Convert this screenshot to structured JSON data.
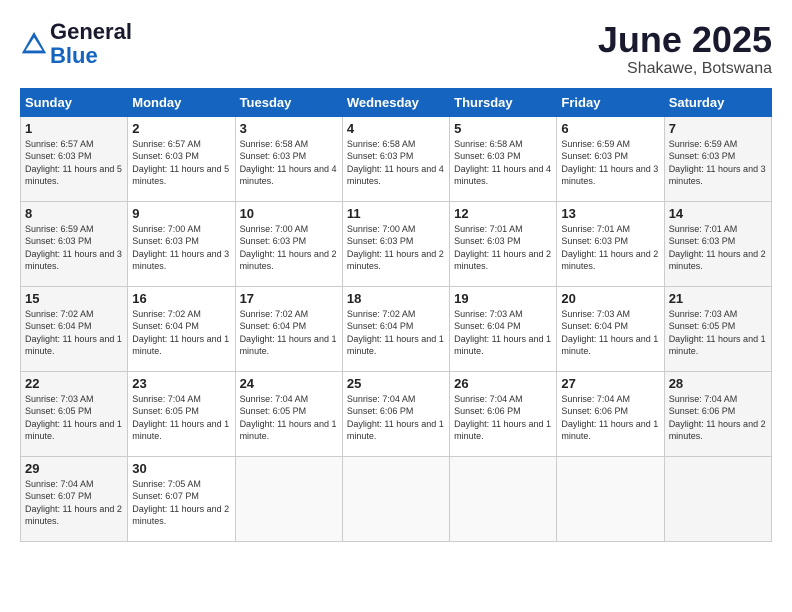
{
  "logo": {
    "general": "General",
    "blue": "Blue"
  },
  "title": {
    "month": "June 2025",
    "location": "Shakawe, Botswana"
  },
  "weekdays": [
    "Sunday",
    "Monday",
    "Tuesday",
    "Wednesday",
    "Thursday",
    "Friday",
    "Saturday"
  ],
  "weeks": [
    [
      {
        "day": "1",
        "info": "Sunrise: 6:57 AM\nSunset: 6:03 PM\nDaylight: 11 hours and 5 minutes."
      },
      {
        "day": "2",
        "info": "Sunrise: 6:57 AM\nSunset: 6:03 PM\nDaylight: 11 hours and 5 minutes."
      },
      {
        "day": "3",
        "info": "Sunrise: 6:58 AM\nSunset: 6:03 PM\nDaylight: 11 hours and 4 minutes."
      },
      {
        "day": "4",
        "info": "Sunrise: 6:58 AM\nSunset: 6:03 PM\nDaylight: 11 hours and 4 minutes."
      },
      {
        "day": "5",
        "info": "Sunrise: 6:58 AM\nSunset: 6:03 PM\nDaylight: 11 hours and 4 minutes."
      },
      {
        "day": "6",
        "info": "Sunrise: 6:59 AM\nSunset: 6:03 PM\nDaylight: 11 hours and 3 minutes."
      },
      {
        "day": "7",
        "info": "Sunrise: 6:59 AM\nSunset: 6:03 PM\nDaylight: 11 hours and 3 minutes."
      }
    ],
    [
      {
        "day": "8",
        "info": "Sunrise: 6:59 AM\nSunset: 6:03 PM\nDaylight: 11 hours and 3 minutes."
      },
      {
        "day": "9",
        "info": "Sunrise: 7:00 AM\nSunset: 6:03 PM\nDaylight: 11 hours and 3 minutes."
      },
      {
        "day": "10",
        "info": "Sunrise: 7:00 AM\nSunset: 6:03 PM\nDaylight: 11 hours and 2 minutes."
      },
      {
        "day": "11",
        "info": "Sunrise: 7:00 AM\nSunset: 6:03 PM\nDaylight: 11 hours and 2 minutes."
      },
      {
        "day": "12",
        "info": "Sunrise: 7:01 AM\nSunset: 6:03 PM\nDaylight: 11 hours and 2 minutes."
      },
      {
        "day": "13",
        "info": "Sunrise: 7:01 AM\nSunset: 6:03 PM\nDaylight: 11 hours and 2 minutes."
      },
      {
        "day": "14",
        "info": "Sunrise: 7:01 AM\nSunset: 6:03 PM\nDaylight: 11 hours and 2 minutes."
      }
    ],
    [
      {
        "day": "15",
        "info": "Sunrise: 7:02 AM\nSunset: 6:04 PM\nDaylight: 11 hours and 1 minute."
      },
      {
        "day": "16",
        "info": "Sunrise: 7:02 AM\nSunset: 6:04 PM\nDaylight: 11 hours and 1 minute."
      },
      {
        "day": "17",
        "info": "Sunrise: 7:02 AM\nSunset: 6:04 PM\nDaylight: 11 hours and 1 minute."
      },
      {
        "day": "18",
        "info": "Sunrise: 7:02 AM\nSunset: 6:04 PM\nDaylight: 11 hours and 1 minute."
      },
      {
        "day": "19",
        "info": "Sunrise: 7:03 AM\nSunset: 6:04 PM\nDaylight: 11 hours and 1 minute."
      },
      {
        "day": "20",
        "info": "Sunrise: 7:03 AM\nSunset: 6:04 PM\nDaylight: 11 hours and 1 minute."
      },
      {
        "day": "21",
        "info": "Sunrise: 7:03 AM\nSunset: 6:05 PM\nDaylight: 11 hours and 1 minute."
      }
    ],
    [
      {
        "day": "22",
        "info": "Sunrise: 7:03 AM\nSunset: 6:05 PM\nDaylight: 11 hours and 1 minute."
      },
      {
        "day": "23",
        "info": "Sunrise: 7:04 AM\nSunset: 6:05 PM\nDaylight: 11 hours and 1 minute."
      },
      {
        "day": "24",
        "info": "Sunrise: 7:04 AM\nSunset: 6:05 PM\nDaylight: 11 hours and 1 minute."
      },
      {
        "day": "25",
        "info": "Sunrise: 7:04 AM\nSunset: 6:06 PM\nDaylight: 11 hours and 1 minute."
      },
      {
        "day": "26",
        "info": "Sunrise: 7:04 AM\nSunset: 6:06 PM\nDaylight: 11 hours and 1 minute."
      },
      {
        "day": "27",
        "info": "Sunrise: 7:04 AM\nSunset: 6:06 PM\nDaylight: 11 hours and 1 minute."
      },
      {
        "day": "28",
        "info": "Sunrise: 7:04 AM\nSunset: 6:06 PM\nDaylight: 11 hours and 2 minutes."
      }
    ],
    [
      {
        "day": "29",
        "info": "Sunrise: 7:04 AM\nSunset: 6:07 PM\nDaylight: 11 hours and 2 minutes."
      },
      {
        "day": "30",
        "info": "Sunrise: 7:05 AM\nSunset: 6:07 PM\nDaylight: 11 hours and 2 minutes."
      },
      {
        "day": "",
        "info": ""
      },
      {
        "day": "",
        "info": ""
      },
      {
        "day": "",
        "info": ""
      },
      {
        "day": "",
        "info": ""
      },
      {
        "day": "",
        "info": ""
      }
    ]
  ]
}
